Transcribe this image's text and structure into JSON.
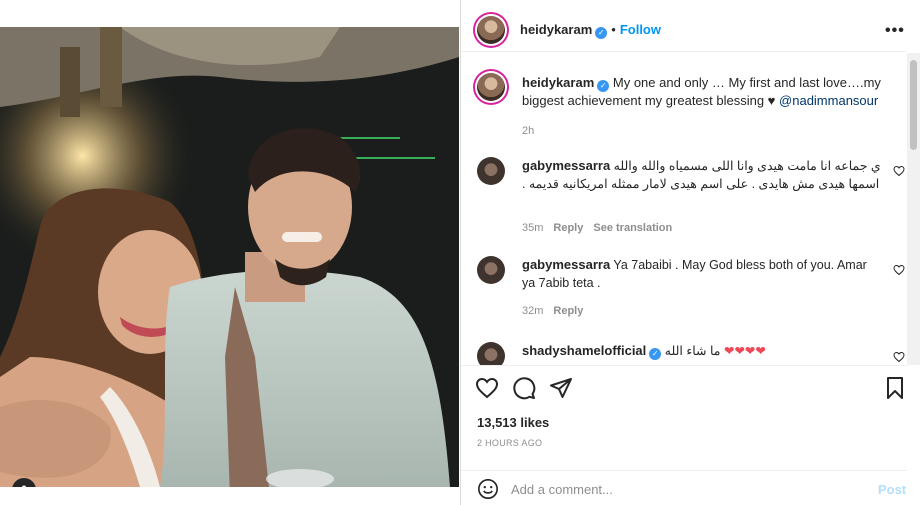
{
  "post_header": {
    "username": "heidykaram",
    "separator": "•",
    "follow_label": "Follow",
    "more_label": "•••"
  },
  "caption": {
    "username": "heidykaram",
    "text": "My one and only … My first and last love….my biggest achievement my greatest blessing ♥",
    "mention": "@nadimmansour",
    "time": "2h"
  },
  "comments": [
    {
      "username": "gabymessarra",
      "text": "ي جماعه انا مامت هيدى وانا اللى مسمياه والله والله اسمها هيدى مش هايدى . على اسم هيدى لامار ممثله امريكانيه قديمه .",
      "time": "35m",
      "reply_label": "Reply",
      "translate_label": "See translation"
    },
    {
      "username": "gabymessarra",
      "text": "Ya 7abaibi . May God bless both of you. Amar ya 7abib teta .",
      "time": "32m",
      "reply_label": "Reply"
    },
    {
      "username": "shadyshamelofficial",
      "text": "ما شاء الله",
      "hearts": "❤❤❤❤"
    }
  ],
  "likes": "13,513 likes",
  "posted": "2 HOURS AGO",
  "add_comment": {
    "placeholder": "Add a comment...",
    "post_label": "Post"
  },
  "colors": {
    "accent": "#0095f6",
    "verified": "#3897f0",
    "muted": "#8e8e8e",
    "heart_red": "#ed4956"
  },
  "icons": [
    "like-icon",
    "comment-icon",
    "share-icon",
    "save-icon",
    "emoji-icon",
    "user-tag-icon",
    "verified-icon"
  ]
}
